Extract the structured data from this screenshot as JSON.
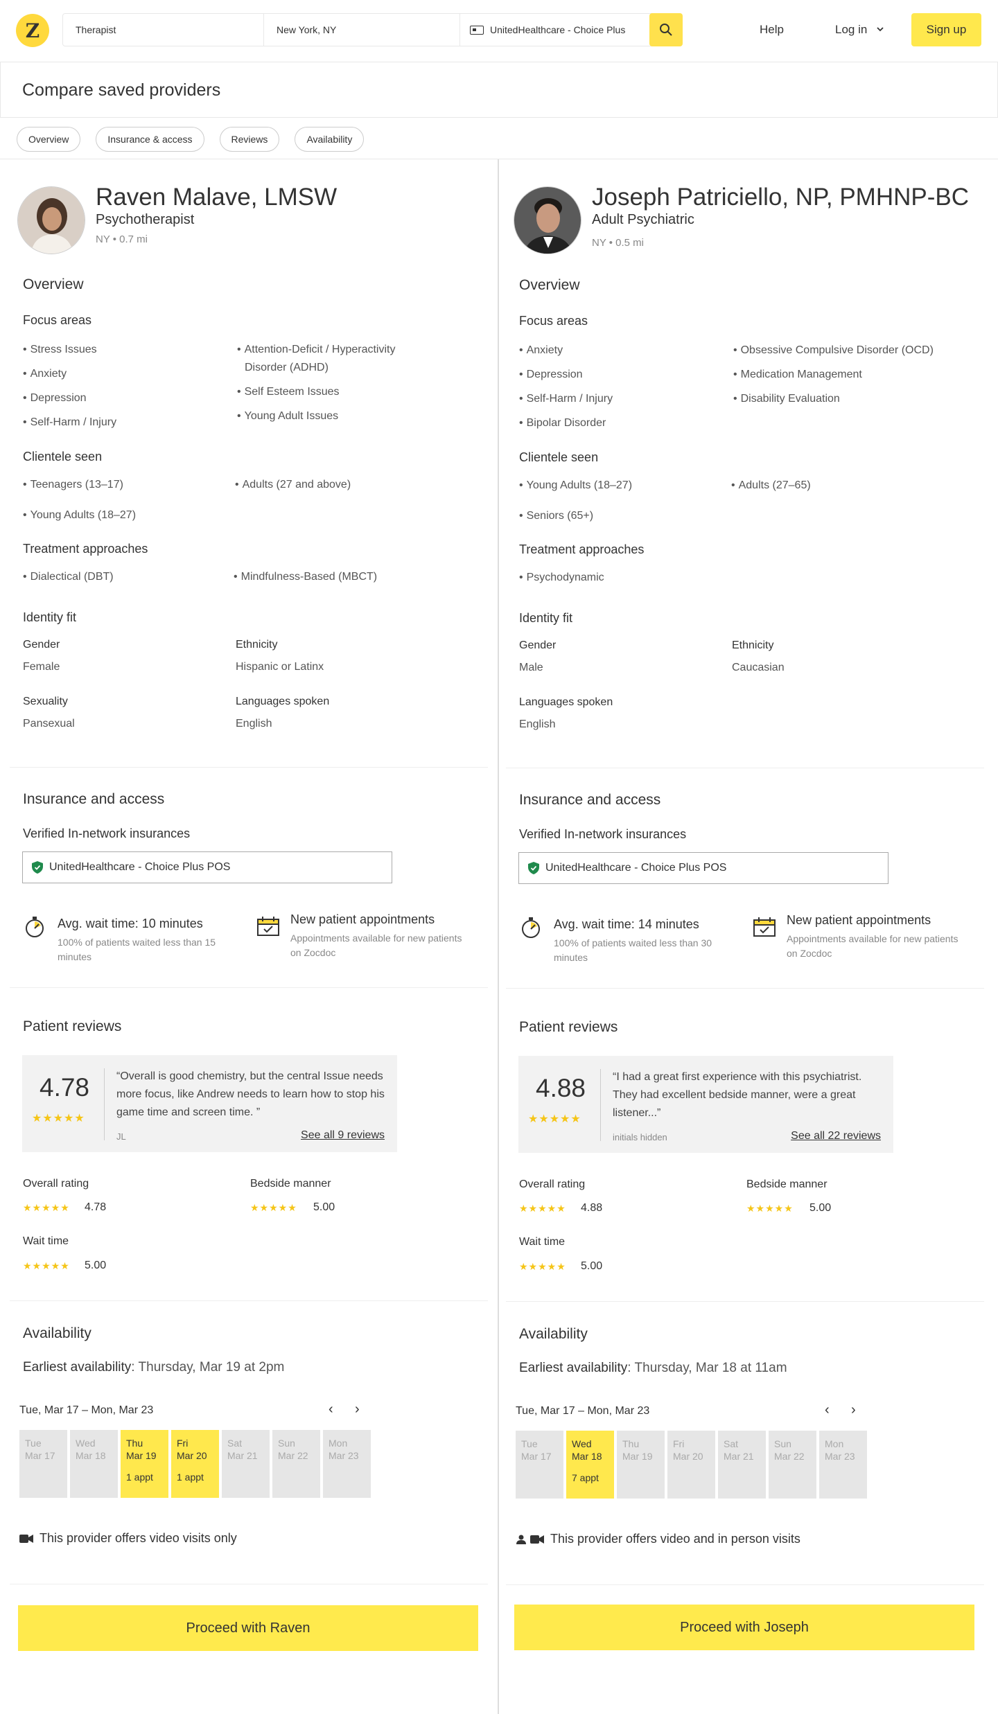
{
  "header": {
    "logo": "Z",
    "search_specialty": "Therapist",
    "search_location": "New York, NY",
    "search_insurance": "UnitedHealthcare - Choice Plus",
    "help": "Help",
    "login": "Log in",
    "signup": "Sign up"
  },
  "page_title": "Compare saved providers",
  "tabs": [
    "Overview",
    "Insurance & access",
    "Reviews",
    "Availability"
  ],
  "labels": {
    "overview": "Overview",
    "focus_areas": "Focus areas",
    "clientele": "Clientele seen",
    "treatment": "Treatment approaches",
    "identity": "Identity fit",
    "gender": "Gender",
    "ethnicity": "Ethnicity",
    "sexuality": "Sexuality",
    "languages": "Languages spoken",
    "insurance_access": "Insurance and access",
    "verified": "Verified In-network insurances",
    "new_patient": "New patient appointments",
    "new_patient_sub": "Appointments available for new patients on Zocdoc",
    "patient_reviews": "Patient reviews",
    "overall": "Overall rating",
    "bedside": "Bedside manner",
    "wait": "Wait time",
    "availability": "Availability",
    "earliest": "Earliest availability",
    "week": "Tue, Mar 17 – Mon, Mar 23",
    "stars": "★★★★★"
  },
  "left": {
    "name": "Raven Malave, LMSW",
    "specialty": "Psychotherapist",
    "location": "NY • 0.7 mi",
    "focus_col1": [
      "Stress Issues",
      "Anxiety",
      "Depression",
      "Self-Harm / Injury"
    ],
    "focus_col2": [
      "Attention-Deficit / Hyperactivity",
      "Disorder (ADHD)",
      "Self Esteem Issues",
      "Young Adult Issues"
    ],
    "clientele_col1": [
      "Teenagers (13–17)",
      "Young Adults (18–27)"
    ],
    "clientele_col2": [
      "Adults (27 and above)"
    ],
    "treatment_col1": [
      "Dialectical (DBT)"
    ],
    "treatment_col2": [
      "Mindfulness-Based (MBCT)"
    ],
    "gender": "Female",
    "ethnicity": "Hispanic or Latinx",
    "sexuality": "Pansexual",
    "languages": "English",
    "insurance": "UnitedHealthcare - Choice Plus POS",
    "wait_title": "Avg. wait time: 10 minutes",
    "wait_sub": "100% of patients waited less than 15 minutes",
    "score": "4.78",
    "quote": "“Overall is good chemistry, but the central Issue needs more focus, like Andrew needs to learn how to stop his game time and screen time. ”",
    "reviewer": "JL",
    "see_all": "See all 9 reviews",
    "overall": "4.78",
    "bedside": "5.00",
    "wait": "5.00",
    "earliest": "Thursday, Mar 19 at 2pm",
    "days": [
      {
        "d": "Tue",
        "m": "Mar 17",
        "a": "",
        "on": false
      },
      {
        "d": "Wed",
        "m": "Mar 18",
        "a": "",
        "on": false
      },
      {
        "d": "Thu",
        "m": "Mar 19",
        "a": "1 appt",
        "on": true
      },
      {
        "d": "Fri",
        "m": "Mar 20",
        "a": "1 appt",
        "on": true
      },
      {
        "d": "Sat",
        "m": "Mar 21",
        "a": "",
        "on": false
      },
      {
        "d": "Sun",
        "m": "Mar 22",
        "a": "",
        "on": false
      },
      {
        "d": "Mon",
        "m": "Mar 23",
        "a": "",
        "on": false
      }
    ],
    "visit": "This provider offers video visits only",
    "proceed": "Proceed with Raven"
  },
  "right": {
    "name": "Joseph Patriciello, NP, PMHNP-BC",
    "specialty": "Adult Psychiatric",
    "location": "NY • 0.5 mi",
    "focus_col1": [
      "Anxiety",
      "Depression",
      "Self-Harm / Injury",
      "Bipolar Disorder"
    ],
    "focus_col2": [
      "Obsessive Compulsive Disorder (OCD)",
      "Medication Management",
      "Disability Evaluation"
    ],
    "clientele_col1": [
      "Young Adults (18–27)",
      "Seniors (65+)"
    ],
    "clientele_col2": [
      "Adults (27–65)"
    ],
    "treatment_col1": [
      "Psychodynamic"
    ],
    "gender": "Male",
    "ethnicity": "Caucasian",
    "languages": "English",
    "insurance": "UnitedHealthcare - Choice Plus POS",
    "wait_title": "Avg. wait time: 14 minutes",
    "wait_sub": "100% of patients waited less than 30 minutes",
    "score": "4.88",
    "quote": "“I had a great first experience with this psychiatrist. They had excellent bedside manner, were a great listener...”",
    "reviewer": "initials hidden",
    "see_all": "See all 22 reviews",
    "overall": "4.88",
    "bedside": "5.00",
    "wait": "5.00",
    "earliest": "Thursday, Mar 18 at 11am",
    "days": [
      {
        "d": "Tue",
        "m": "Mar 17",
        "a": "",
        "on": false
      },
      {
        "d": "Wed",
        "m": "Mar 18",
        "a": "7 appt",
        "on": true
      },
      {
        "d": "Thu",
        "m": "Mar 19",
        "a": "",
        "on": false
      },
      {
        "d": "Fri",
        "m": "Mar 20",
        "a": "",
        "on": false
      },
      {
        "d": "Sat",
        "m": "Mar 21",
        "a": "",
        "on": false
      },
      {
        "d": "Sun",
        "m": "Mar 22",
        "a": "",
        "on": false
      },
      {
        "d": "Mon",
        "m": "Mar 23",
        "a": "",
        "on": false
      }
    ],
    "visit": "This provider offers video and in person visits",
    "proceed": "Proceed with Joseph"
  },
  "colors": {
    "brand_yellow": "#ffe84d",
    "star": "#f5c518",
    "shield_green": "#1f8a4c"
  }
}
